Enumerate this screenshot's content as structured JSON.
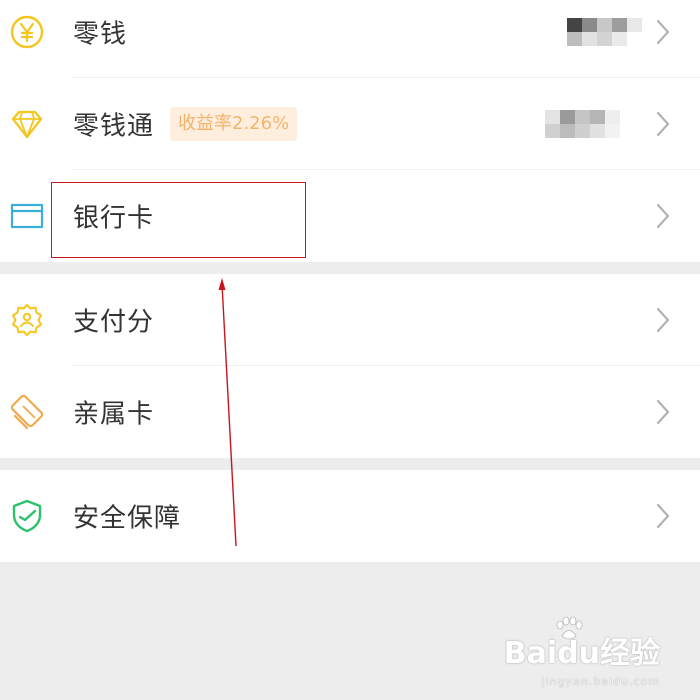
{
  "wallet": {
    "items": [
      {
        "label": "零钱",
        "icon": "yen-coin-icon",
        "amount_hidden": true,
        "rate_badge": ""
      },
      {
        "label": "零钱通",
        "icon": "diamond-icon",
        "amount_hidden": true,
        "rate_badge": "收益率2.26%"
      },
      {
        "label": "银行卡",
        "icon": "bank-card-icon",
        "amount_hidden": false,
        "rate_badge": ""
      }
    ],
    "items_group2": [
      {
        "label": "支付分",
        "icon": "pay-score-badge-icon"
      },
      {
        "label": "亲属卡",
        "icon": "family-card-icon"
      }
    ],
    "items_group3": [
      {
        "label": "安全保障",
        "icon": "security-shield-icon"
      }
    ]
  },
  "annotation": {
    "highlight_color": "#c8161e",
    "target": "银行卡"
  },
  "watermark": {
    "main": "Baidu经验",
    "sub": "jingyan.baidu.com"
  },
  "colors": {
    "background": "#ededed",
    "card": "#ffffff",
    "text": "#333333",
    "chevron": "#b2b2b2",
    "badge_bg": "#fdeedd",
    "badge_text": "#f3b46f",
    "yellow_icon": "#f5c620",
    "blue_icon": "#3ab0d8",
    "orange_icon": "#f1a94d",
    "green_icon": "#2dc16b"
  }
}
